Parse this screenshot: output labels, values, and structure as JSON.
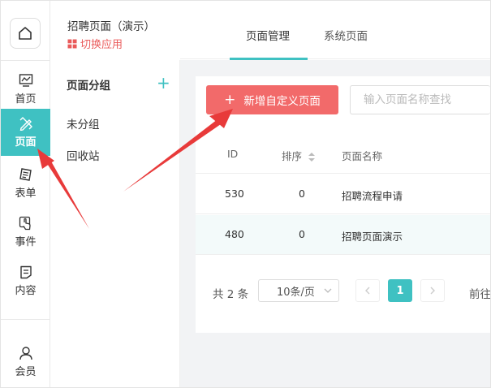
{
  "app": {
    "title": "招聘页面（演示）",
    "switch_label": "切换应用"
  },
  "rail": {
    "items": [
      {
        "label": "首页",
        "icon": "monitor-icon"
      },
      {
        "label": "页面",
        "icon": "pencil-ruler-icon",
        "active": true
      },
      {
        "label": "表单",
        "icon": "form-icon"
      },
      {
        "label": "事件",
        "icon": "hand-pointer-icon"
      },
      {
        "label": "内容",
        "icon": "document-icon"
      },
      {
        "label": "会员",
        "icon": "user-icon"
      }
    ]
  },
  "groups": {
    "title": "页面分组",
    "add_symbol": "+",
    "items": [
      "未分组",
      "回收站"
    ]
  },
  "tabs": [
    {
      "label": "页面管理",
      "active": true
    },
    {
      "label": "系统页面",
      "active": false
    }
  ],
  "toolbar": {
    "add_label": "新增自定义页面",
    "add_symbol": "+",
    "search_placeholder": "输入页面名称查找"
  },
  "table": {
    "columns": [
      "ID",
      "排序",
      "页面名称"
    ],
    "rows": [
      {
        "id": "530",
        "order": "0",
        "name": "招聘流程申请"
      },
      {
        "id": "480",
        "order": "0",
        "name": "招聘页面演示"
      }
    ]
  },
  "pagination": {
    "total": "共 2 条",
    "page_size": "10条/页",
    "current_page": "1",
    "goto_label": "前往"
  },
  "colors": {
    "accent": "#3fc1c2",
    "danger": "#f26a6a",
    "annotation_arrow": "#e83a3a"
  }
}
